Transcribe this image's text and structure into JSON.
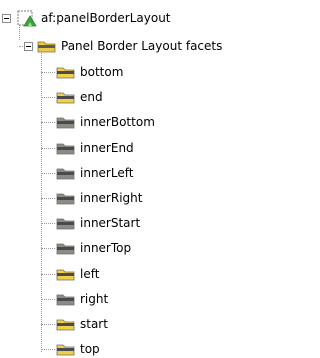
{
  "tree": {
    "root": {
      "label": "af:panelBorderLayout",
      "icon": "component-node-icon"
    },
    "group": {
      "label": "Panel Border Layout facets",
      "icon": "folder-icon"
    },
    "facets": [
      {
        "label": "bottom",
        "highlighted": true
      },
      {
        "label": "end",
        "highlighted": true
      },
      {
        "label": "innerBottom",
        "highlighted": false
      },
      {
        "label": "innerEnd",
        "highlighted": false
      },
      {
        "label": "innerLeft",
        "highlighted": false
      },
      {
        "label": "innerRight",
        "highlighted": false
      },
      {
        "label": "innerStart",
        "highlighted": false
      },
      {
        "label": "innerTop",
        "highlighted": false
      },
      {
        "label": "left",
        "highlighted": true
      },
      {
        "label": "right",
        "highlighted": false
      },
      {
        "label": "start",
        "highlighted": true
      },
      {
        "label": "top",
        "highlighted": true
      }
    ]
  },
  "colors": {
    "facet_highlight": "#f2cf45",
    "facet_normal": "#8c8c86",
    "folder": "#e9c84a",
    "root_node": "#3aa53a"
  }
}
